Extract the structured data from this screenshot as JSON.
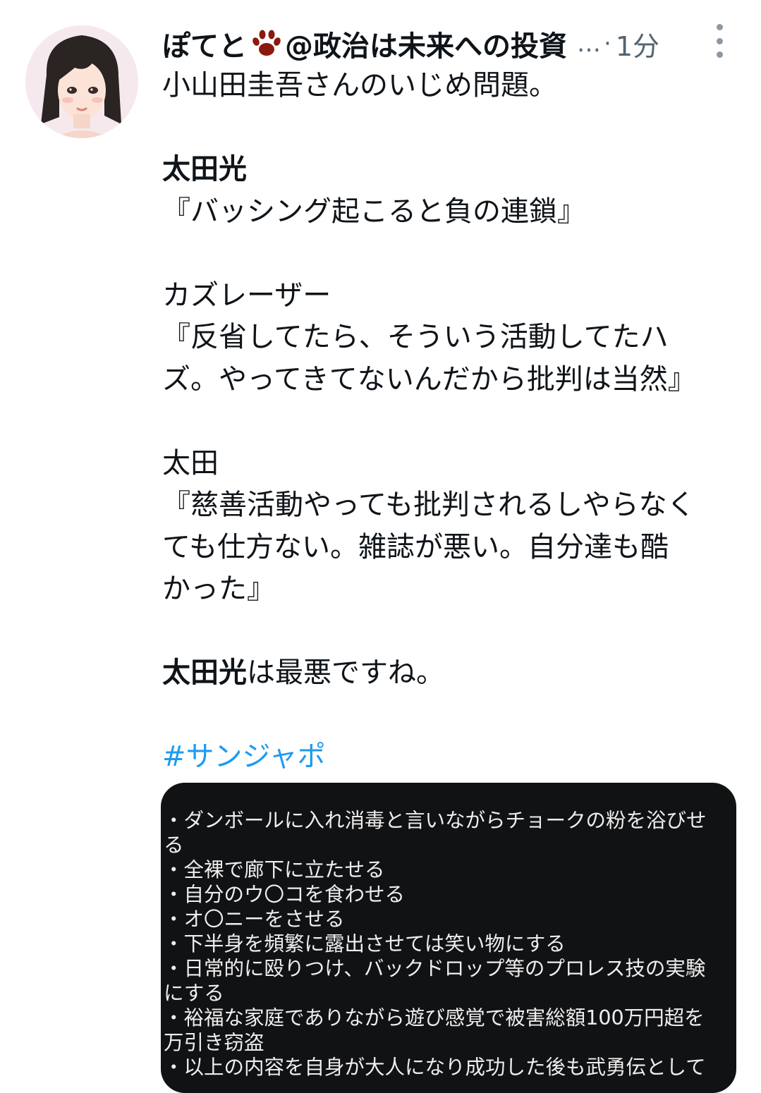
{
  "author": {
    "display_name_part1": "ぽてと",
    "paw_icon": "paw-print-icon",
    "display_name_part2": "@政治は未来への投資",
    "truncation": "…",
    "separator": "·",
    "timestamp": "1分"
  },
  "tweet": {
    "lines": [
      "小山田圭吾さんのいじめ問題。",
      "",
      "太田光",
      "『バッシング起こると負の連鎖』",
      "",
      "カズレーザー",
      "『反省してたら、そういう活動してたハ",
      "ズ。やってきてないんだから批判は当然』",
      "",
      "太田",
      "『慈善活動やっても批判されるしやらなく",
      "ても仕方ない。雑誌が悪い。自分達も酷",
      "かった』",
      "",
      "",
      ""
    ],
    "closing_bold": "太田光",
    "closing_rest": "は最悪ですね。",
    "hashtag": "#サンジャポ"
  },
  "media_text": {
    "lines": [
      "・ダンボールに入れ消毒と言いながらチョークの粉を浴びせ",
      "る",
      "・全裸で廊下に立たせる",
      "・自分のウ〇コを食わせる",
      "・オ〇ニーをさせる",
      "・下半身を頻繁に露出させては笑い物にする",
      "・日常的に殴りつけ、バックドロップ等のプロレス技の実験",
      "にする",
      "・裕福な家庭でありながら遊び感覚で被害総額100万円超を",
      "万引き窃盗",
      "・以上の内容を自身が大人になり成功した後も武勇伝として"
    ]
  },
  "colors": {
    "text": "#0f1419",
    "secondary": "#536471",
    "hashtag": "#1d9bf0",
    "media_bg": "#111214",
    "paw": "#8b1a0e"
  }
}
